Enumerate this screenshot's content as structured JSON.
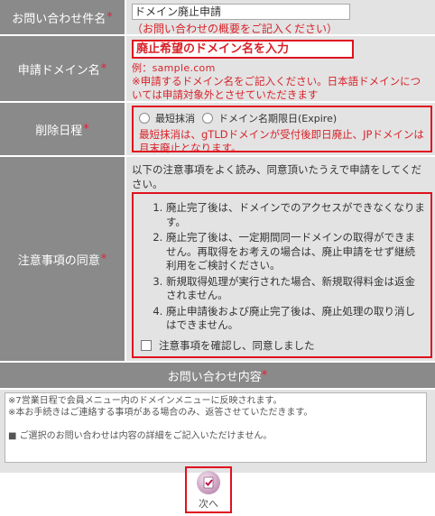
{
  "subject": {
    "label": "お問い合わせ件名",
    "required_mark": "*",
    "value": "ドメイン廃止申請",
    "hint": "（お問い合わせの概要をご記入ください）"
  },
  "domain": {
    "label": "申請ドメイン名",
    "required_mark": "*",
    "placeholder": "廃止希望のドメイン名を入力",
    "example": "例：sample.com",
    "note": "※申請するドメイン名をご記入ください。日本語ドメインについては申請対象外とさせていただきます"
  },
  "schedule": {
    "label": "削除日程",
    "required_mark": "*",
    "options": [
      "最短抹消",
      "ドメイン名期限日(Expire)"
    ],
    "note": "最短抹消は、gTLDドメインが受付後即日廃止、JPドメインは月末廃止となります。"
  },
  "agreement": {
    "label": "注意事項の同意",
    "required_mark": "*",
    "intro": "以下の注意事項をよく読み、同意頂いたうえで申請をしてください。",
    "items": [
      "廃止完了後は、ドメインでのアクセスができなくなります。",
      "廃止完了後は、一定期間同一ドメインの取得ができません。再取得をお考えの場合は、廃止申請をせず継続利用をご検討ください。",
      "新規取得処理が実行された場合、新規取得料金は返金されません。",
      "廃止申請後および廃止完了後は、廃止処理の取り消しはできません。"
    ],
    "checkbox_label": "注意事項を確認し、同意しました"
  },
  "contents": {
    "header": "お問い合わせ内容",
    "required_mark": "*",
    "line1": "※7営業日程で会員メニュー内のドメインメニューに反映されます。",
    "line2": "※本お手続きはご連絡する事項がある場合のみ、返答させていただきます。",
    "line3": "■ ご選択のお問い合わせは内容の詳細をご記入いただけません。"
  },
  "next_button": {
    "label": "次へ",
    "icon": "check-document-icon"
  },
  "colors": {
    "label_bg": "#8a8a8a",
    "cell_bg": "#e3e3e3",
    "accent_red": "#d8232a",
    "highlight_border": "#e0111f"
  }
}
